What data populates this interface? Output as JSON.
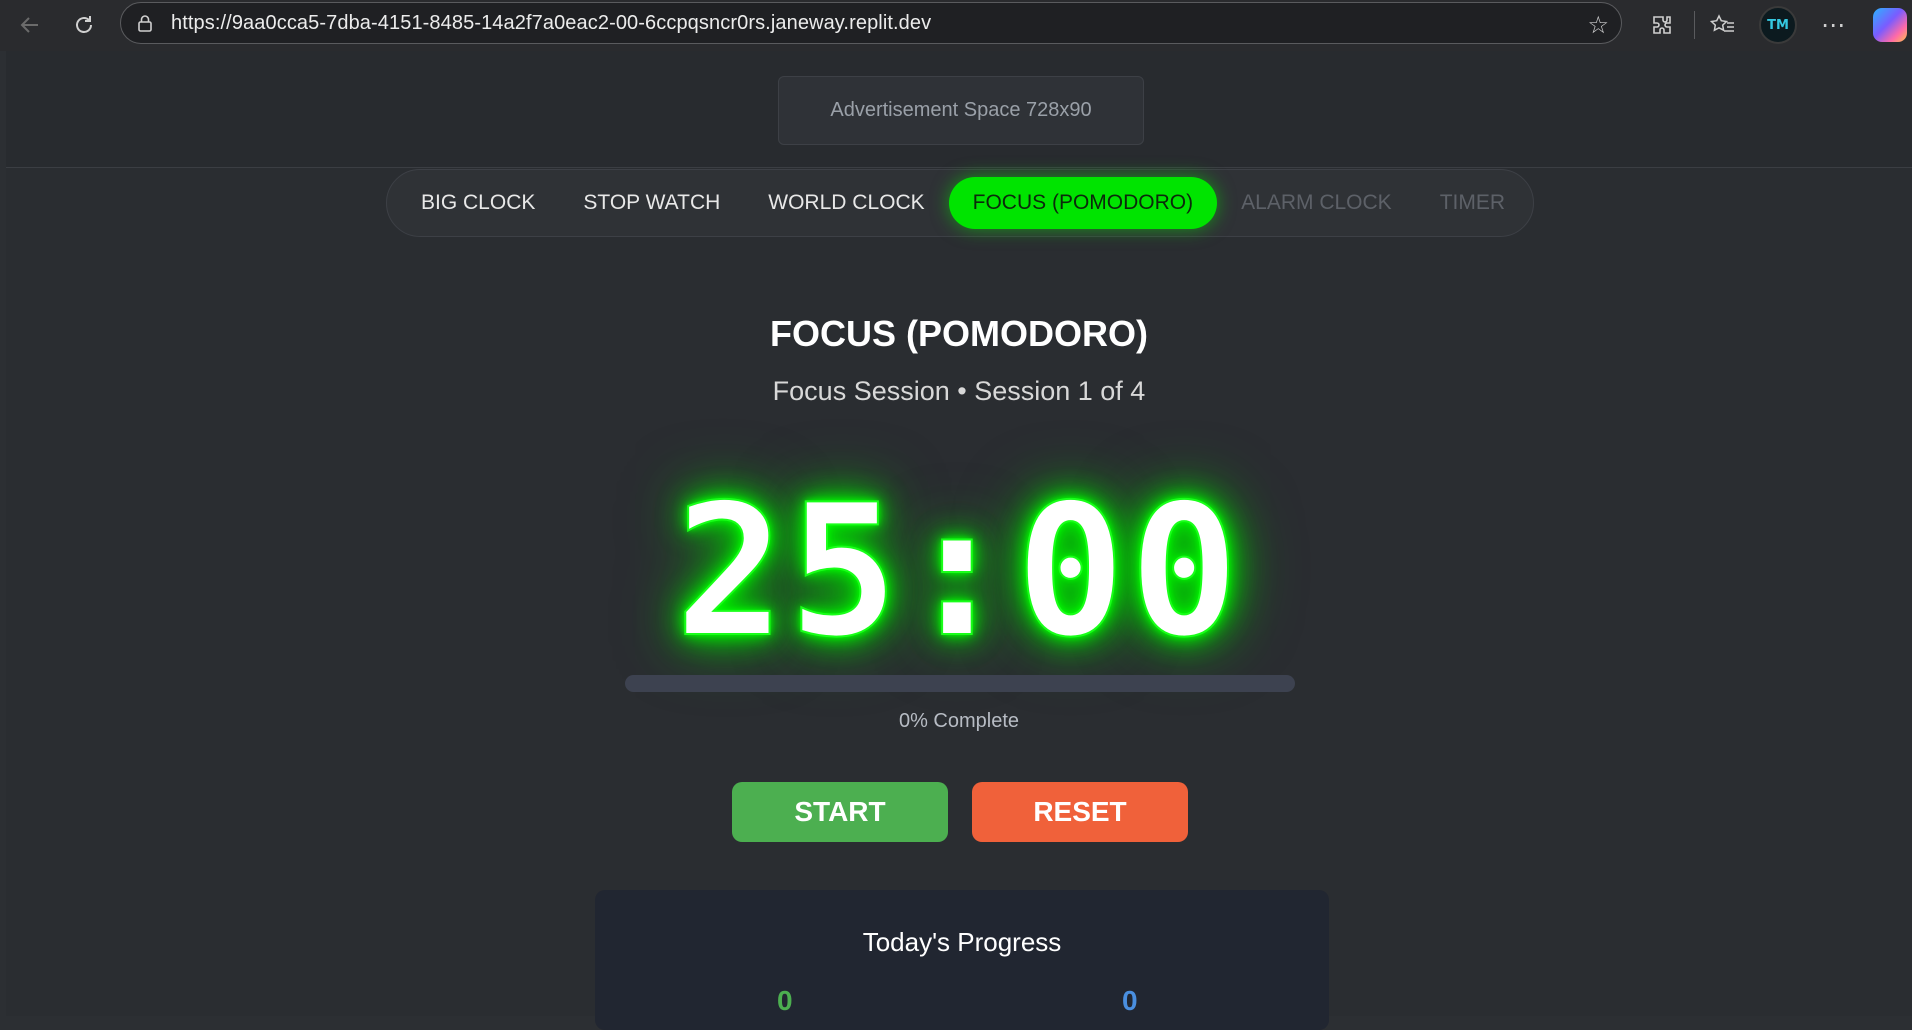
{
  "browser": {
    "url": "https://9aa0cca5-7dba-4151-8485-14a2f7a0eac2-00-6ccpqsncr0rs.janeway.replit.dev",
    "profile_initials": "TM"
  },
  "ad": {
    "label": "Advertisement Space 728x90"
  },
  "tabs": [
    {
      "label": "BIG CLOCK",
      "state": "normal"
    },
    {
      "label": "STOP WATCH",
      "state": "normal"
    },
    {
      "label": "WORLD CLOCK",
      "state": "normal"
    },
    {
      "label": "FOCUS (POMODORO)",
      "state": "active"
    },
    {
      "label": "ALARM CLOCK",
      "state": "disabled"
    },
    {
      "label": "TIMER",
      "state": "disabled"
    }
  ],
  "focus": {
    "title": "FOCUS (POMODORO)",
    "subtitle": "Focus Session • Session 1 of 4",
    "time": "25:00",
    "progress_percent": 0,
    "progress_label": "0% Complete",
    "start_label": "START",
    "reset_label": "RESET"
  },
  "stats": {
    "title": "Today's Progress",
    "sessions_value": "0",
    "minutes_value": "0"
  },
  "colors": {
    "accent": "#00e400",
    "start": "#4caf50",
    "reset": "#f0613a"
  }
}
